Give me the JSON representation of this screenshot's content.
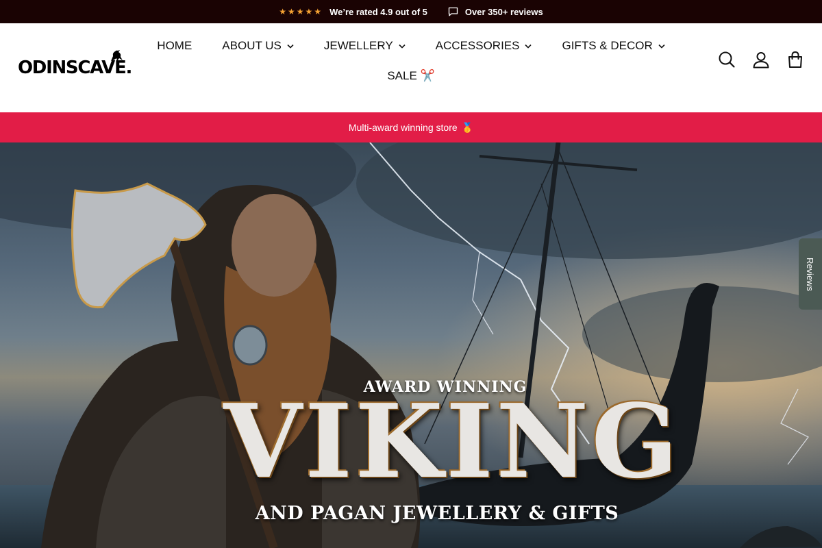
{
  "announcement": {
    "stars": "★★★★★",
    "rating_text": "We’re rated 4.9 out of 5",
    "reviews_text": "Over 350+ reviews"
  },
  "header": {
    "logo_text": "ODINSCAVE.",
    "nav": [
      {
        "label": "HOME",
        "has_dropdown": false
      },
      {
        "label": "ABOUT US",
        "has_dropdown": true
      },
      {
        "label": "JEWELLERY",
        "has_dropdown": true
      },
      {
        "label": "ACCESSORIES",
        "has_dropdown": true
      },
      {
        "label": "GIFTS & DECOR",
        "has_dropdown": true
      }
    ],
    "sale_label": "SALE ✂️",
    "icons": [
      "search-icon",
      "account-icon",
      "cart-icon"
    ]
  },
  "promo": {
    "text": "Multi-award winning store",
    "emoji": "🥇"
  },
  "hero": {
    "subtitle_top": "AWARD WINNING",
    "title": "VIKING",
    "subtitle_bottom": "AND PAGAN JEWELLERY & GIFTS"
  },
  "side_tab": {
    "label": "Reviews"
  },
  "colors": {
    "topbar_bg": "#1a0303",
    "star": "#f4a233",
    "promo_bg": "#e21d47",
    "reviews_tab_bg": "#4b5a54"
  }
}
